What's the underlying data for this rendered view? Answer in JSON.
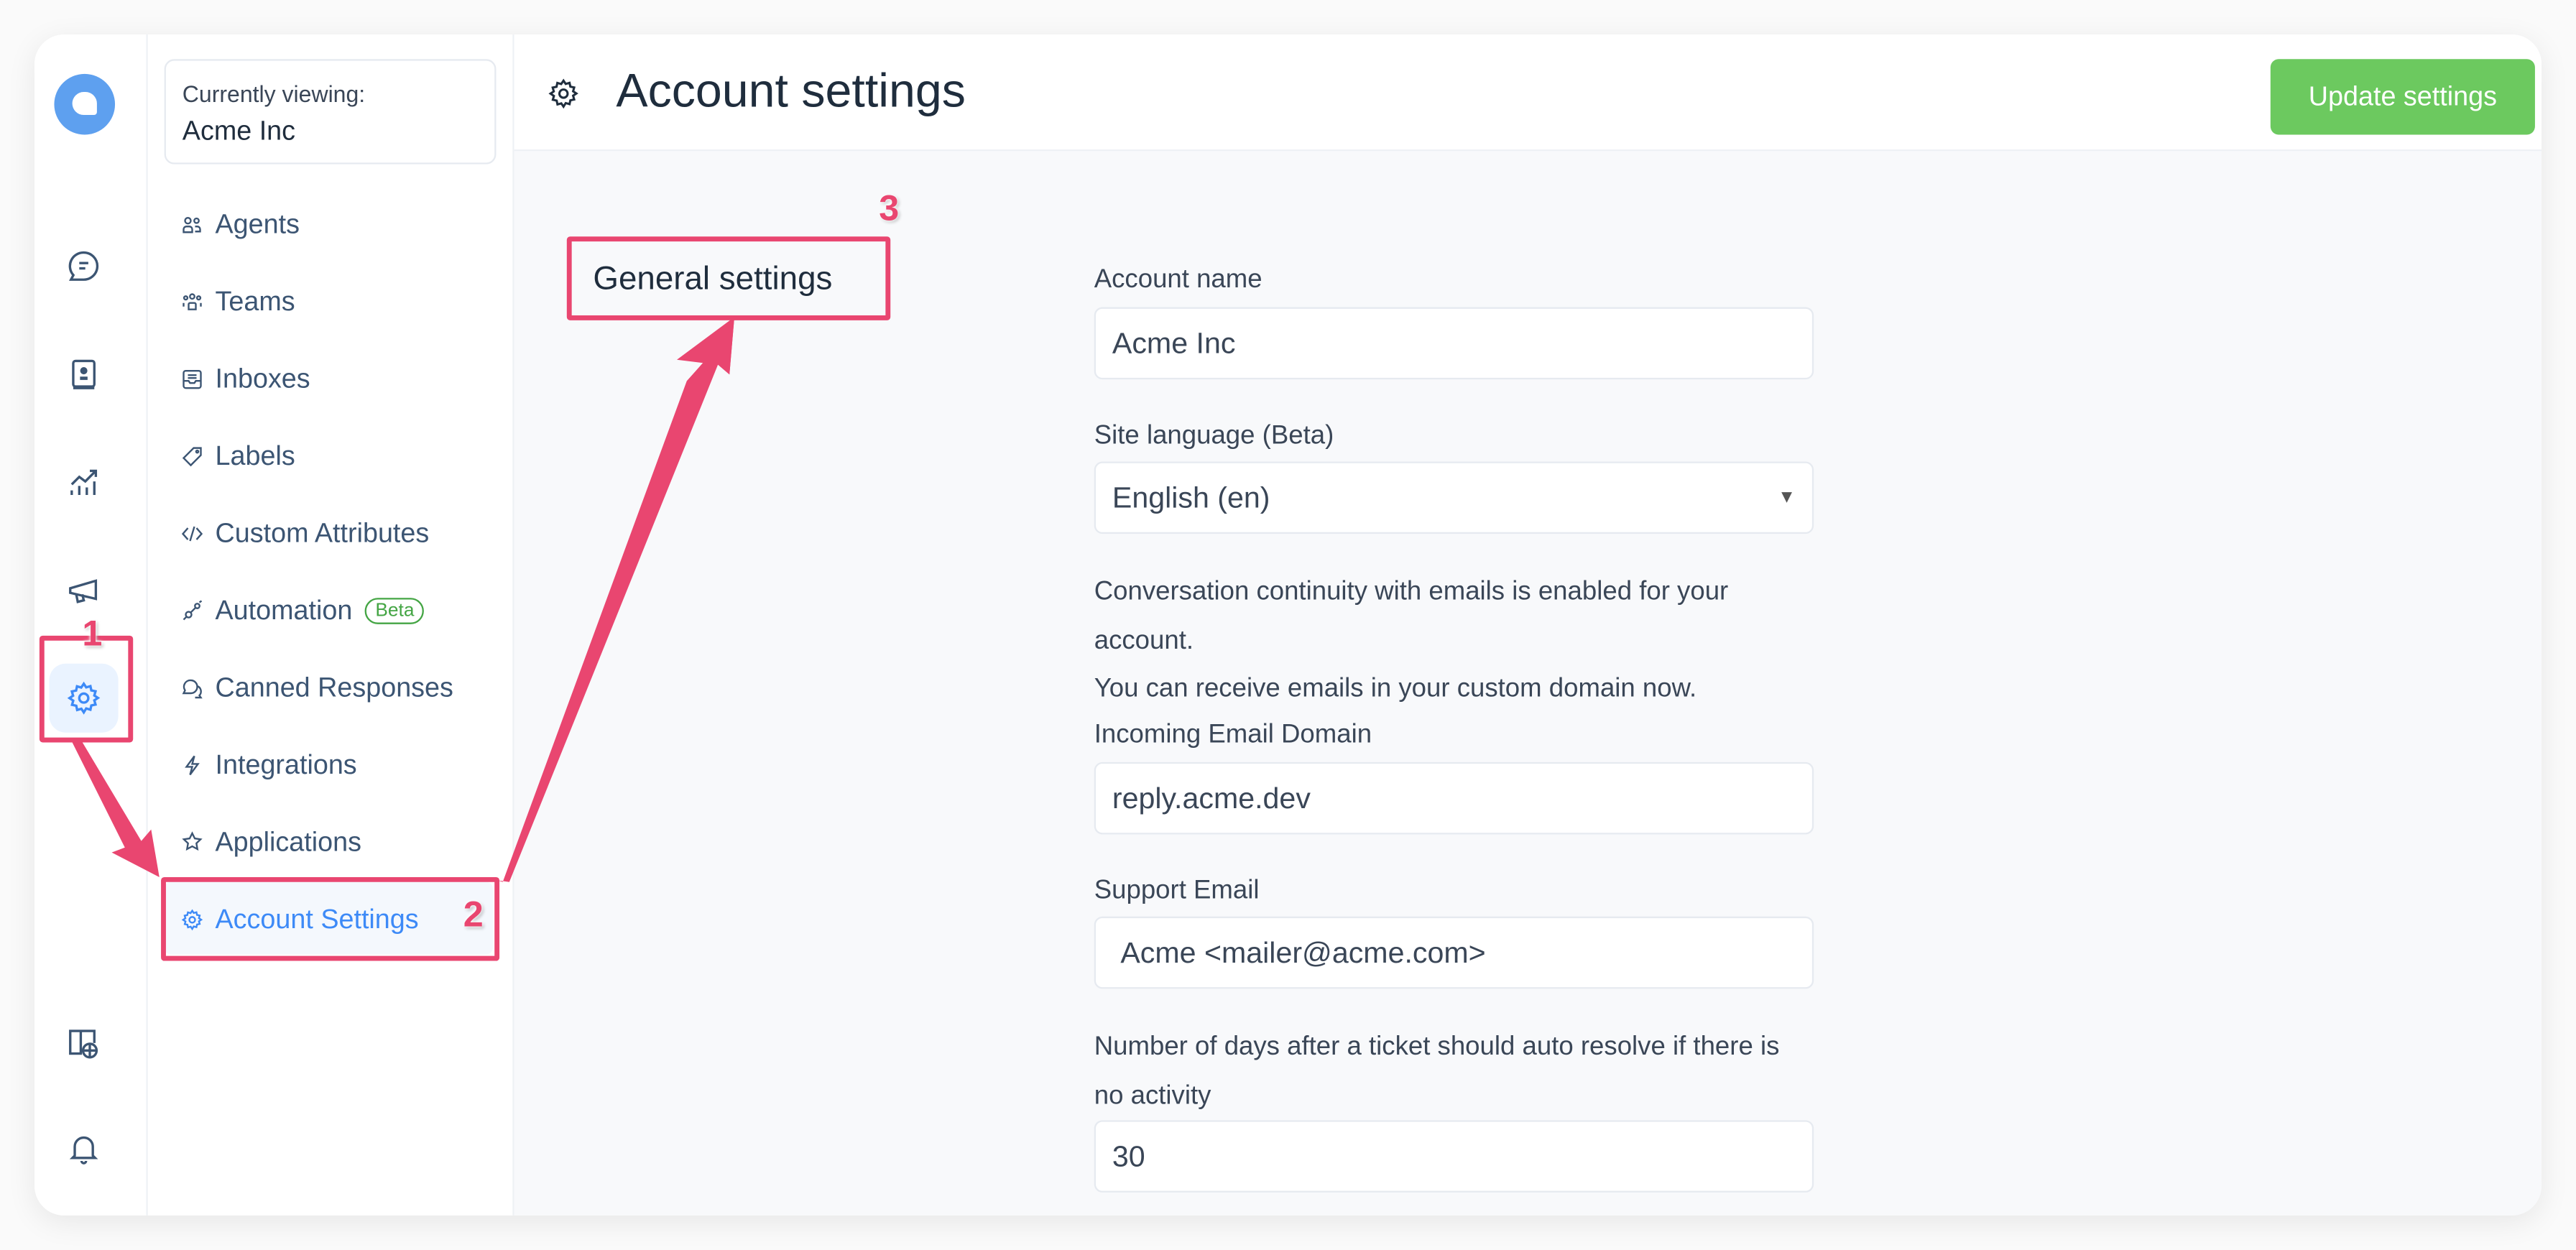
{
  "rail": {
    "items": [
      {
        "icon": "chat-bubble-icon",
        "label": "Conversations"
      },
      {
        "icon": "contacts-book-icon",
        "label": "Contacts"
      },
      {
        "icon": "reports-chart-icon",
        "label": "Reports"
      },
      {
        "icon": "megaphone-icon",
        "label": "Campaigns"
      },
      {
        "icon": "gear-icon",
        "label": "Settings",
        "active": true
      },
      {
        "icon": "help-center-book-globe-icon",
        "label": "Help Center"
      },
      {
        "icon": "bell-icon",
        "label": "Notifications"
      }
    ]
  },
  "account_switcher": {
    "label": "Currently viewing:",
    "value": "Acme Inc"
  },
  "settings_nav": {
    "items": [
      {
        "label": "Agents",
        "icon": "agents-icon"
      },
      {
        "label": "Teams",
        "icon": "teams-icon"
      },
      {
        "label": "Inboxes",
        "icon": "inbox-icon"
      },
      {
        "label": "Labels",
        "icon": "tag-icon"
      },
      {
        "label": "Custom Attributes",
        "icon": "code-icon"
      },
      {
        "label": "Automation",
        "icon": "automation-icon",
        "badge": "Beta"
      },
      {
        "label": "Canned Responses",
        "icon": "chat-bubbles-icon"
      },
      {
        "label": "Integrations",
        "icon": "flash-icon"
      },
      {
        "label": "Applications",
        "icon": "star-badge-icon"
      },
      {
        "label": "Account Settings",
        "icon": "gear-icon",
        "active": true
      }
    ]
  },
  "header": {
    "title": "Account settings",
    "update_button": "Update settings"
  },
  "section": {
    "title": "General settings"
  },
  "form": {
    "account_name": {
      "label": "Account name",
      "value": "Acme Inc"
    },
    "site_language": {
      "label": "Site language (Beta)",
      "value": "English (en)"
    },
    "continuity_note": "Conversation continuity with emails is enabled for your account.",
    "custom_domain_note": "You can receive emails in your custom domain now.",
    "incoming_domain": {
      "label": "Incoming Email Domain",
      "value": "reply.acme.dev"
    },
    "support_email": {
      "label": "Support Email",
      "value": "Acme <mailer@acme.com>"
    },
    "auto_resolve": {
      "label": "Number of days after a ticket should auto resolve if there is no activity",
      "value": "30"
    }
  },
  "annotations": {
    "one": "1",
    "two": "2",
    "three": "3"
  },
  "colors": {
    "accent": "#3d8af7",
    "primary_button": "#6cc95f",
    "annotation": "#e94670",
    "beta": "#44a544"
  }
}
